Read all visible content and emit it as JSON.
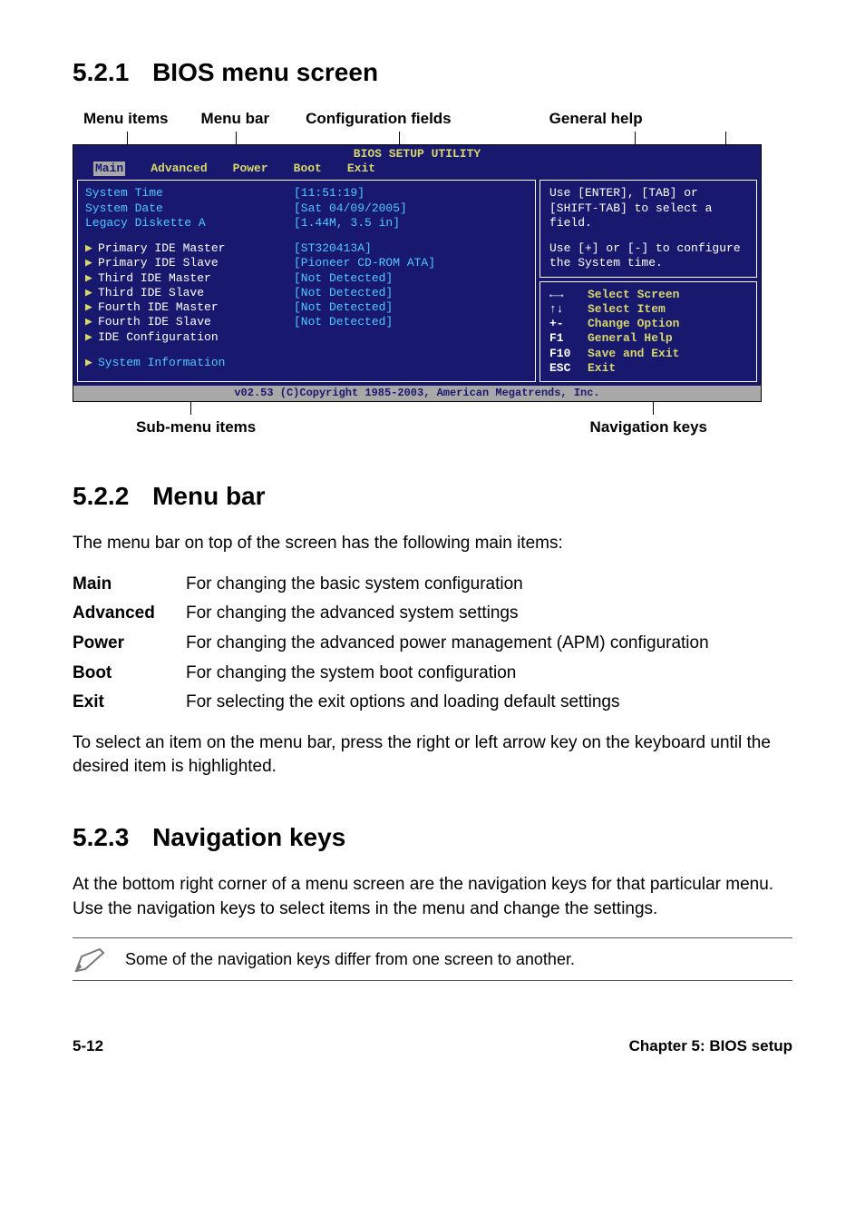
{
  "section_521": {
    "num": "5.2.1",
    "title": "BIOS menu screen"
  },
  "toplabels": {
    "menu_items": "Menu items",
    "menu_bar": "Menu bar",
    "config_fields": "Configuration fields",
    "general_help": "General help"
  },
  "bios": {
    "title": "BIOS SETUP UTILITY",
    "tabs": [
      "Main",
      "Advanced",
      "Power",
      "Boot",
      "Exit"
    ],
    "active_tab": "Main",
    "left_top": [
      "System Time",
      "System Date",
      "Legacy Diskette A"
    ],
    "left_sub": [
      "Primary IDE Master",
      "Primary IDE Slave",
      "Third IDE Master",
      "Third IDE Slave",
      "Fourth IDE Master",
      "Fourth IDE Slave",
      "IDE Configuration"
    ],
    "left_last": "System Information",
    "mid_top": [
      "[11:51:19]",
      "[Sat 04/09/2005]",
      "[1.44M, 3.5 in]"
    ],
    "mid_sub": [
      "[ST320413A]",
      "[Pioneer CD-ROM ATA]",
      "[Not Detected]",
      "[Not Detected]",
      "[Not Detected]",
      "[Not Detected]"
    ],
    "help1": "Use [ENTER], [TAB] or [SHIFT-TAB] to select a field.",
    "help2": "Use [+] or [-] to configure the System time.",
    "navkeys": [
      {
        "key": "←→",
        "label": "Select Screen"
      },
      {
        "key": "↑↓",
        "label": "Select Item"
      },
      {
        "key": "+-",
        "label": "Change Option"
      },
      {
        "key": "F1",
        "label": "General Help"
      },
      {
        "key": "F10",
        "label": "Save and Exit"
      },
      {
        "key": "ESC",
        "label": "Exit"
      }
    ],
    "footer": "v02.53 (C)Copyright 1985-2003, American Megatrends, Inc."
  },
  "bottomlabels": {
    "submenu": "Sub-menu items",
    "navkeys": "Navigation keys"
  },
  "section_522": {
    "num": "5.2.2",
    "title": "Menu bar",
    "intro": "The menu bar on top of the screen has the following main items:",
    "items": [
      {
        "term": "Main",
        "desc": "For changing the basic system configuration"
      },
      {
        "term": "Advanced",
        "desc": "For changing the advanced system settings"
      },
      {
        "term": "Power",
        "desc": "For changing the advanced power management (APM) configuration"
      },
      {
        "term": "Boot",
        "desc": "For changing the system boot configuration"
      },
      {
        "term": "Exit",
        "desc": "For selecting the exit options and loading default settings"
      }
    ],
    "outro": "To select an item on the menu bar, press the right or left arrow key on the keyboard until the desired item is highlighted."
  },
  "section_523": {
    "num": "5.2.3",
    "title": "Navigation keys",
    "body": "At the bottom right corner of a menu screen are the navigation keys for that particular menu. Use the navigation keys to select items in the menu and change the settings.",
    "note": "Some of the navigation keys differ from one screen to another."
  },
  "footer": {
    "left": "5-12",
    "right": "Chapter 5: BIOS setup"
  }
}
